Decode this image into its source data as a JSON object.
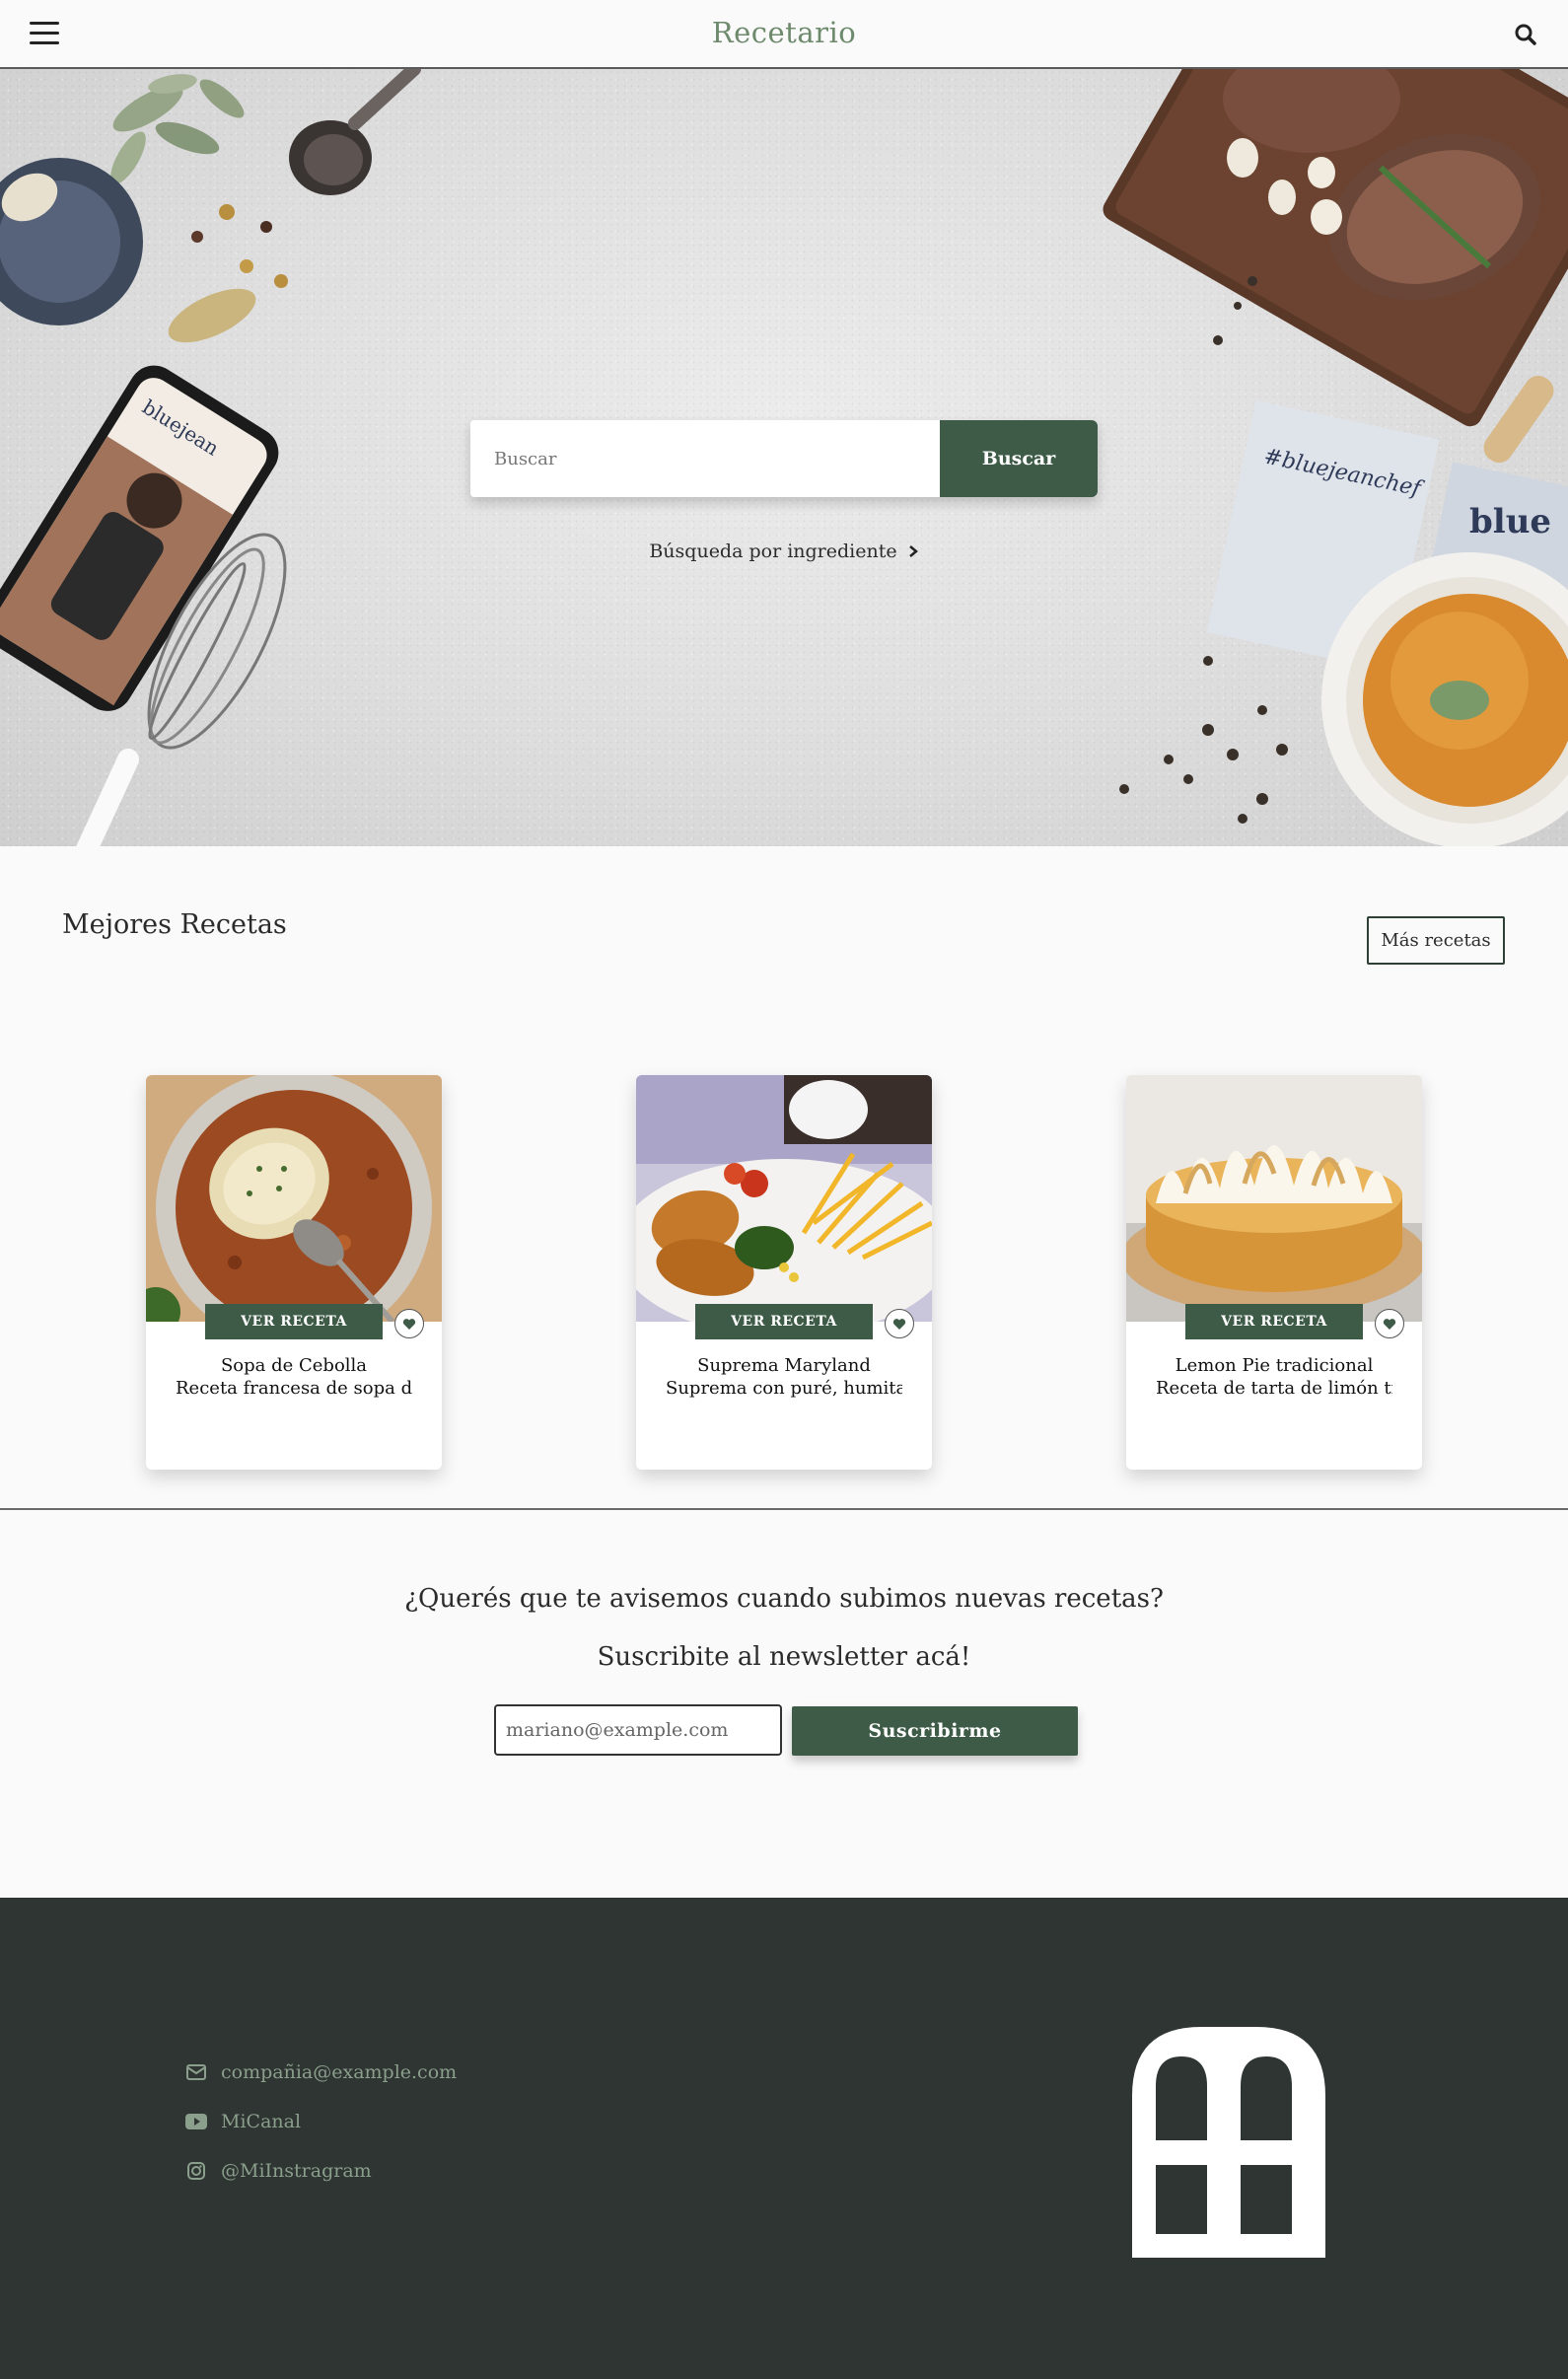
{
  "header": {
    "brand": "Recetario",
    "menu_icon": "hamburger-menu-icon",
    "search_icon": "search-icon"
  },
  "hero": {
    "search_placeholder": "Buscar",
    "search_button": "Buscar",
    "ingredient_link": "Búsqueda por ingrediente",
    "chevron_icon": "chevron-right-icon"
  },
  "best_recipes": {
    "title": "Mejores Recetas",
    "more_button": "Más recetas",
    "cards": [
      {
        "image": "onion-soup-photo",
        "button": "VER RECETA",
        "title": "Sopa de Cebolla",
        "description": "Receta francesa de sopa de cebolla"
      },
      {
        "image": "suprema-maryland-photo",
        "button": "VER RECETA",
        "title": "Suprema Maryland",
        "description": "Suprema con puré, humita, morrón"
      },
      {
        "image": "lemon-pie-photo",
        "button": "VER RECETA",
        "title": "Lemon Pie tradicional",
        "description": "Receta de tarta de limón tradicional"
      }
    ]
  },
  "newsletter": {
    "question": "¿Querés que te avisemos cuando subimos nuevas recetas?",
    "subtitle": "Suscribite al newsletter acá!",
    "email_placeholder": "mariano@example.com",
    "subscribe_button": "Suscribirme"
  },
  "footer": {
    "email": "compañia@example.com",
    "youtube": "MiCanal",
    "instagram": "@MiInstragram",
    "logo_icon": "recetario-window-logo"
  },
  "colors": {
    "accent": "#3e5b47",
    "brand": "#6e8a6c",
    "footer_bg": "#2f3532",
    "footer_text": "#8a9f8c"
  }
}
